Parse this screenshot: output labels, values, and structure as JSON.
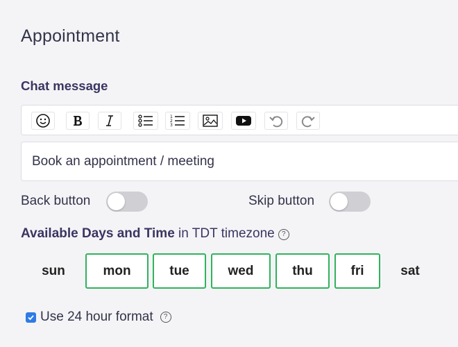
{
  "page": {
    "title": "Appointment"
  },
  "chat_message": {
    "label": "Chat message",
    "toolbar": [
      {
        "name": "emoji-button",
        "icon": "smiley-icon"
      },
      {
        "name": "bold-button",
        "icon": "bold-icon"
      },
      {
        "name": "italic-button",
        "icon": "italic-icon"
      },
      {
        "name": "bullet-list-button",
        "icon": "bullet-list-icon"
      },
      {
        "name": "numbered-list-button",
        "icon": "numbered-list-icon"
      },
      {
        "name": "image-button",
        "icon": "image-icon"
      },
      {
        "name": "youtube-button",
        "icon": "youtube-icon"
      },
      {
        "name": "undo-button",
        "icon": "undo-icon"
      },
      {
        "name": "redo-button",
        "icon": "redo-icon"
      }
    ],
    "value": "Book an appointment / meeting"
  },
  "toggles": {
    "back": {
      "label": "Back button",
      "on": false
    },
    "skip": {
      "label": "Skip button",
      "on": false
    }
  },
  "availability": {
    "title": "Available Days and Time",
    "suffix": " in TDT timezone",
    "days": [
      {
        "label": "sun",
        "selected": false
      },
      {
        "label": "mon",
        "selected": true
      },
      {
        "label": "tue",
        "selected": true
      },
      {
        "label": "wed",
        "selected": true
      },
      {
        "label": "thu",
        "selected": true
      },
      {
        "label": "fri",
        "selected": true
      },
      {
        "label": "sat",
        "selected": false
      }
    ]
  },
  "time_format": {
    "label": "Use 24 hour format",
    "checked": true
  },
  "colors": {
    "accent_green": "#2fb35a",
    "checkbox_blue": "#2f7be6",
    "toggle_off": "#cfcfd4"
  }
}
